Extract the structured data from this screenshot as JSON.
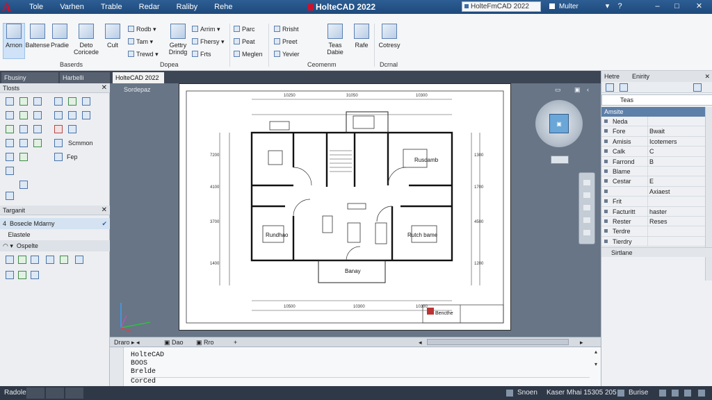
{
  "title_bar": {
    "app_title": "HolteCAD 2022",
    "search_value": "HolteFmCAD 2022",
    "user_label": "Multer",
    "menu": [
      "Tole",
      "Varhen",
      "Trable",
      "Redar",
      "Raliby",
      "Rehe"
    ]
  },
  "ribbon": {
    "big_buttons": [
      "Arnon",
      "Baltense",
      "Pradie",
      "Deto\nCoricede",
      "Cult",
      "Gettry\nDrindg",
      "Teas\nDabie",
      "Rafe",
      "Cotresy"
    ],
    "small_items": {
      "modify_col1": [
        "Rodb",
        "Tam",
        "Trewd"
      ],
      "modify_col2": [
        "Arrim",
        "Fhersy",
        "Frts"
      ],
      "annot_col": [
        "Parc",
        "Peat",
        "Meglen"
      ],
      "layers_col": [
        "Rrisht",
        "Preet",
        "Yevier"
      ]
    },
    "panels": [
      "Baserds",
      "Ceomenm",
      "Dcrnal"
    ],
    "panel_sub": "Dopea"
  },
  "tabs": {
    "start": "Fbusiny",
    "file2": "Harbelli",
    "active": "HolteCAD 2022",
    "view_label": "Sordepaz"
  },
  "left_panel": {
    "tools_header": "Tlosts",
    "snap_label": "Scmmon",
    "fp_label": "Fep",
    "toolpal_header": "Targanit",
    "row_checked": "Bosecle Mdarny",
    "row_2": "Elastele",
    "row_3": "Ospelte"
  },
  "drawing": {
    "room_labels": {
      "bed1": "Rusdamb",
      "bed2": "Rundhao",
      "bed3": "Rutch bame",
      "balcony": "Banay"
    },
    "title_block": "Bencthe",
    "dims_top": [
      "10250",
      "31050",
      "10300"
    ],
    "dims_bottom": [
      "10500",
      "10300",
      "10300"
    ],
    "dims_left": [
      "7200",
      "4100",
      "3700",
      "1400"
    ],
    "dims_right": [
      "1300",
      "1700",
      "4500",
      "1200"
    ]
  },
  "model_strip": {
    "model": "Draro",
    "layout1": "Dao",
    "layout2": "Rro"
  },
  "command": {
    "line1": "HolteCAD",
    "line2": "BOOS",
    "line3": "Brelde",
    "line4": "CorCed"
  },
  "properties": {
    "header_left": "Hetre",
    "header_right": "Enirity",
    "filter": "Teas",
    "section": "Amsite",
    "rows": [
      {
        "k": "Neda",
        "v": ""
      },
      {
        "k": "Fore",
        "v": "Bwait"
      },
      {
        "k": "Amisis",
        "v": "Icotemers"
      },
      {
        "k": "Calk",
        "v": "C"
      },
      {
        "k": "Farrond",
        "v": "B"
      },
      {
        "k": "Blame",
        "v": ""
      },
      {
        "k": "Cestar",
        "v": "E"
      },
      {
        "k": "",
        "v": "Axiaest"
      },
      {
        "k": "Frit",
        "v": ""
      },
      {
        "k": "Facturitt",
        "v": "haster"
      },
      {
        "k": "Rester",
        "v": "Reses"
      },
      {
        "k": "Terdre",
        "v": ""
      },
      {
        "k": "Tierdry",
        "v": ""
      }
    ],
    "footer": "Sirtlane"
  },
  "status_bar": {
    "left": "Radole",
    "space": "Snoen",
    "coords": "Kaser Mhai 15305 205",
    "mode": "Burise"
  }
}
